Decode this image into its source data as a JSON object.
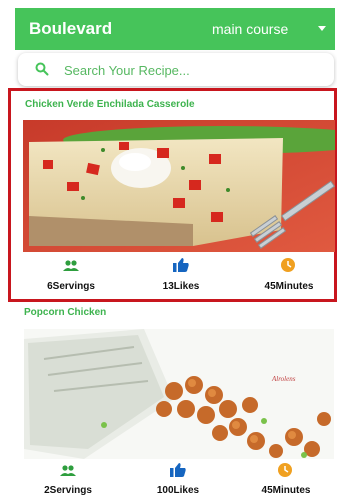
{
  "app": {
    "title": "Boulevard",
    "category": "main course"
  },
  "search": {
    "placeholder": "Search Your Recipe..."
  },
  "recipes": [
    {
      "title": "Chicken Verde Enchilada Casserole",
      "servings": "6Servings",
      "likes": "13Likes",
      "minutes": "45Minutes"
    },
    {
      "title": "Popcorn Chicken",
      "servings": "2Servings",
      "likes": "100Likes",
      "minutes": "45Minutes",
      "image_text": "Alrolens"
    }
  ],
  "colors": {
    "brand": "#46c45a",
    "accent_text": "#3db34e",
    "like_icon": "#1565c0",
    "time_icon": "#f0a020",
    "servings_icon": "#2e9e3e",
    "selection": "#c8161e"
  },
  "icons": {
    "search": "search-icon",
    "servings": "people-icon",
    "likes": "thumbs-up-icon",
    "time": "clock-icon",
    "dropdown": "caret-down-icon"
  }
}
